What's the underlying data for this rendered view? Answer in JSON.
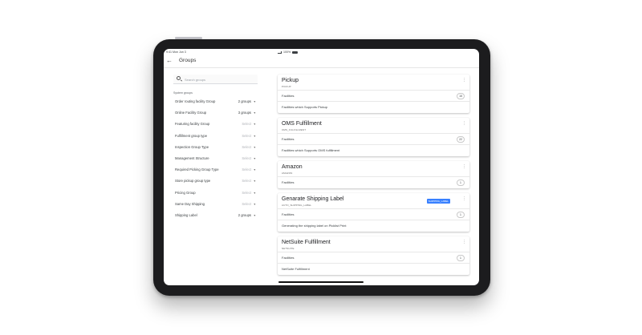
{
  "status_bar": {
    "time": "9:41  Mon Jun 3",
    "battery": "100%"
  },
  "app_bar": {
    "title": "Groups"
  },
  "search": {
    "placeholder": "Search groups"
  },
  "system_groups": {
    "label": "System groups",
    "items": [
      {
        "label": "Order routing facility Group",
        "value": "2 groups"
      },
      {
        "label": "Online Facility Group",
        "value": "3 groups"
      },
      {
        "label": "Featuring facility Group",
        "value": "Select"
      },
      {
        "label": "Fulfillment group type",
        "value": "Select"
      },
      {
        "label": "Inspection Group Type",
        "value": "Select"
      },
      {
        "label": "Management Structure",
        "value": "Select"
      },
      {
        "label": "Required Picking Group Type",
        "value": "Select"
      },
      {
        "label": "Store pickup group type",
        "value": "Select"
      },
      {
        "label": "Pricing Group",
        "value": "Select"
      },
      {
        "label": "Same Day Shipping",
        "value": "Select"
      },
      {
        "label": "Shipping Label",
        "value": "2 groups"
      }
    ]
  },
  "cards": [
    {
      "title": "Pickup",
      "subtitle": "PICKUP",
      "badge": "",
      "facilities_label": "Facilities",
      "count": "15",
      "description": "Facilities which Supports Pickup"
    },
    {
      "title": "OMS Fulfillment",
      "subtitle": "OMS_FULFILLMENT",
      "badge": "",
      "facilities_label": "Facilities",
      "count": "22",
      "description": "Facilities which Supports OMS fulfillment"
    },
    {
      "title": "Amazon",
      "subtitle": "AMAZON",
      "badge": "",
      "facilities_label": "Facilities",
      "count": "1",
      "description": ""
    },
    {
      "title": "Genarate Shipping Label",
      "subtitle": "AUTO_SHIPPING_LABEL",
      "badge": "SHIPPING_LABEL",
      "facilities_label": "Facilities",
      "count": "1",
      "description": "Generating the shipping label on Picklist Print"
    },
    {
      "title": "NetSuite Fulfillment",
      "subtitle": "NETSUITE",
      "badge": "",
      "facilities_label": "Facilities",
      "count": "1",
      "description": "NetSuite Fulfillment"
    }
  ],
  "colors": {
    "badge": "#3880ff",
    "device_frame": "#1c1c1e",
    "background": "#ffffff"
  }
}
